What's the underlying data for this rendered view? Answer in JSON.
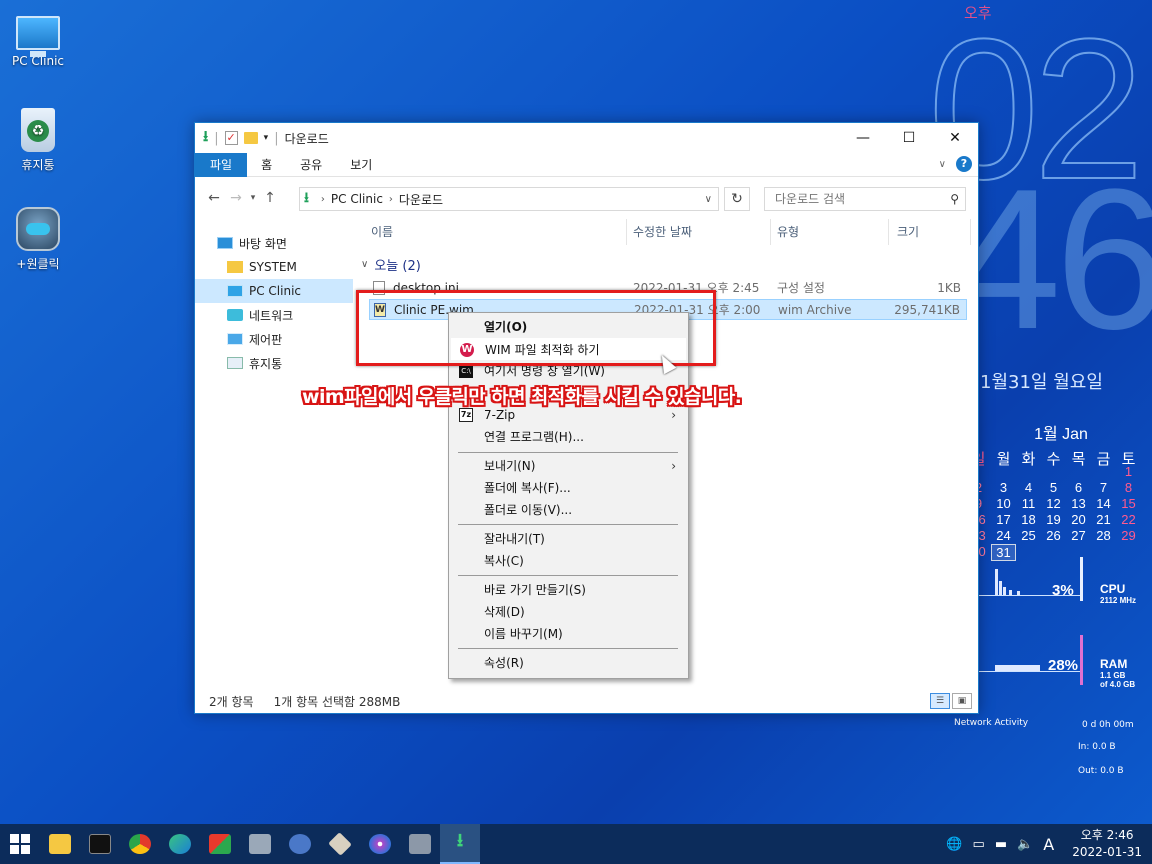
{
  "desktop": {
    "icons": [
      {
        "label": "PC Clinic"
      },
      {
        "label": "휴지통"
      },
      {
        "label": "+원클릭"
      }
    ]
  },
  "clock": {
    "ampm": "오후",
    "hour": "02",
    "minute": "46",
    "date": "1월31일  월요일"
  },
  "calendar": {
    "title": "1월 Jan",
    "weekdays": [
      "일",
      "월",
      "화",
      "수",
      "목",
      "금",
      "토"
    ],
    "weeks": [
      [
        "",
        "",
        "",
        "",
        "",
        "",
        "1"
      ],
      [
        "2",
        "3",
        "4",
        "5",
        "6",
        "7",
        "8"
      ],
      [
        "9",
        "10",
        "11",
        "12",
        "13",
        "14",
        "15"
      ],
      [
        "16",
        "17",
        "18",
        "19",
        "20",
        "21",
        "22"
      ],
      [
        "23",
        "24",
        "25",
        "26",
        "27",
        "28",
        "29"
      ],
      [
        "30",
        "31",
        "",
        "",
        "",
        "",
        ""
      ]
    ],
    "today": "31"
  },
  "monitor": {
    "cpu": {
      "percent": "3%",
      "label": "CPU",
      "sub": "2112 MHz"
    },
    "ram": {
      "percent": "28%",
      "label": "RAM",
      "sub1": "1.1 GB",
      "sub2": "of 4.0 GB"
    },
    "network": {
      "label": "Network Activity",
      "uptime": "0 d 0h 00m",
      "in": "In: 0.0 B",
      "out": "Out: 0.0 B"
    }
  },
  "window": {
    "title": "다운로드",
    "ribbon_tabs": [
      "파일",
      "홈",
      "공유",
      "보기"
    ],
    "address": {
      "segments": [
        "PC Clinic",
        "다운로드"
      ]
    },
    "search_placeholder": "다운로드 검색",
    "nav": [
      {
        "label": "바탕 화면"
      },
      {
        "label": "SYSTEM"
      },
      {
        "label": "PC Clinic"
      },
      {
        "label": "네트워크"
      },
      {
        "label": "제어판"
      },
      {
        "label": "휴지통"
      }
    ],
    "columns": [
      "이름",
      "수정한 날짜",
      "유형",
      "크기"
    ],
    "group": "오늘 (2)",
    "files": [
      {
        "name": "desktop.ini",
        "date": "2022-01-31 오후 2:45",
        "type": "구성 설정",
        "size": "1KB"
      },
      {
        "name": "Clinic PE.wim",
        "date": "2022-01-31 오후 2:00",
        "type": "wim Archive",
        "size": "295,741KB"
      }
    ],
    "status": {
      "count": "2개 항목",
      "selected": "1개 항목 선택함 288MB"
    }
  },
  "context_menu": {
    "items": [
      "열기(O)",
      "WIM 파일 최적화 하기",
      "여기서 명령 창 열기(W)",
      "7-Zip",
      "연결 프로그램(H)...",
      "보내기(N)",
      "폴더에 복사(F)...",
      "폴더로 이동(V)...",
      "잘라내기(T)",
      "복사(C)",
      "바로 가기 만들기(S)",
      "삭제(D)",
      "이름 바꾸기(M)",
      "속성(R)"
    ]
  },
  "annotation": {
    "caption": "wim파일에서 우클릭만 하면 최적화를 시킬 수 있습니다.",
    "color": "#e31c1c"
  },
  "taskbar": {
    "apps": [
      "file-explorer-icon",
      "terminal-icon",
      "chrome-icon",
      "edge-icon",
      "app-icon",
      "drive-tool-icon",
      "network-tool-icon",
      "package-icon",
      "disc-icon",
      "virtualbox-icon",
      "download-icon"
    ],
    "ime": "A",
    "time": "오후 2:46",
    "date": "2022-01-31"
  },
  "colors": {
    "accent": "#1979ca",
    "desktop_blue": "#0b4fc4",
    "taskbar": "#0c2c5b",
    "selection": "#cce8ff"
  }
}
